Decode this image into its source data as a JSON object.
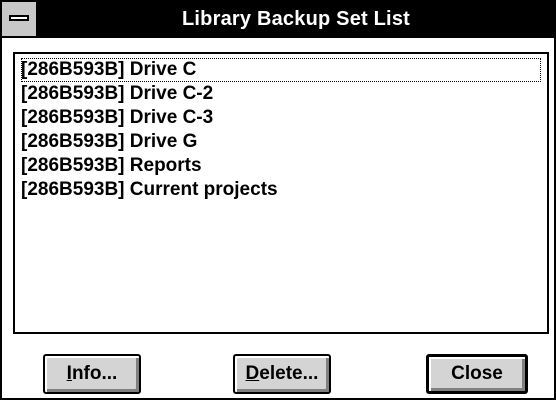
{
  "window": {
    "title": "Library Backup Set List"
  },
  "backup_sets": [
    "[286B593B] Drive C",
    "[286B593B] Drive C-2",
    "[286B593B] Drive C-3",
    "[286B593B] Drive G",
    "[286B593B] Reports",
    "[286B593B] Current projects"
  ],
  "buttons": {
    "info": {
      "mnemonic": "I",
      "rest": "nfo..."
    },
    "delete": {
      "mnemonic": "D",
      "rest": "elete..."
    },
    "close": {
      "label": "Close"
    }
  },
  "icons": {
    "system_menu": "system-menu-icon"
  }
}
